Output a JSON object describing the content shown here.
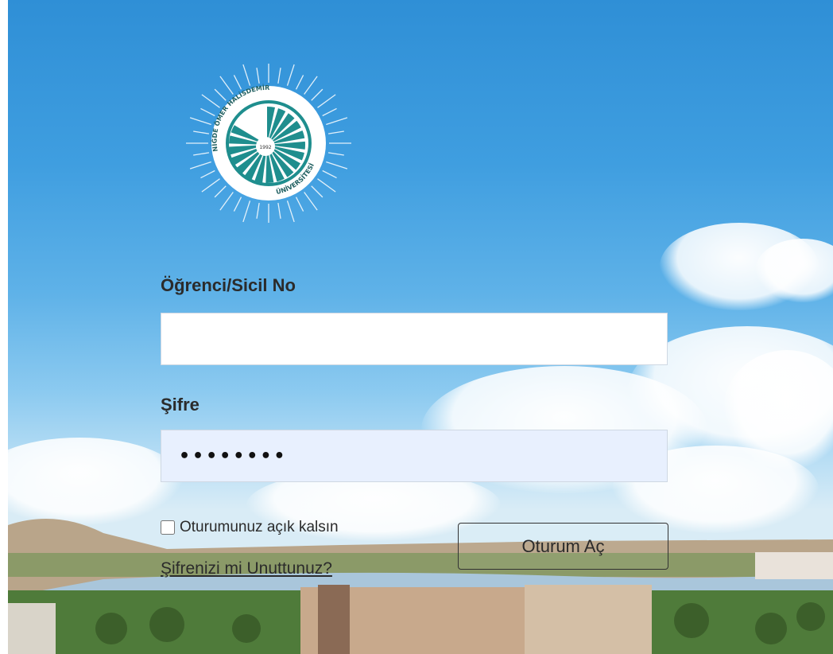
{
  "logo": {
    "text_top": "NİĞDE ÖMER HALİSDEMİR",
    "text_bottom": "ÜNİVERSİTESİ",
    "year": "1992"
  },
  "form": {
    "username_label": "Öğrenci/Sicil No",
    "username_value": "",
    "password_label": "Şifre",
    "password_value": "••••••••",
    "remember_label": "Oturumunuz açık kalsın",
    "remember_checked": false,
    "login_button": "Oturum Aç",
    "forgot_link": "Şifrenizi mi Unuttunuz?"
  },
  "colors": {
    "sky_top": "#2f8fd6",
    "sky_bottom": "#d9ecf6",
    "logo_teal": "#1f8e8e"
  }
}
